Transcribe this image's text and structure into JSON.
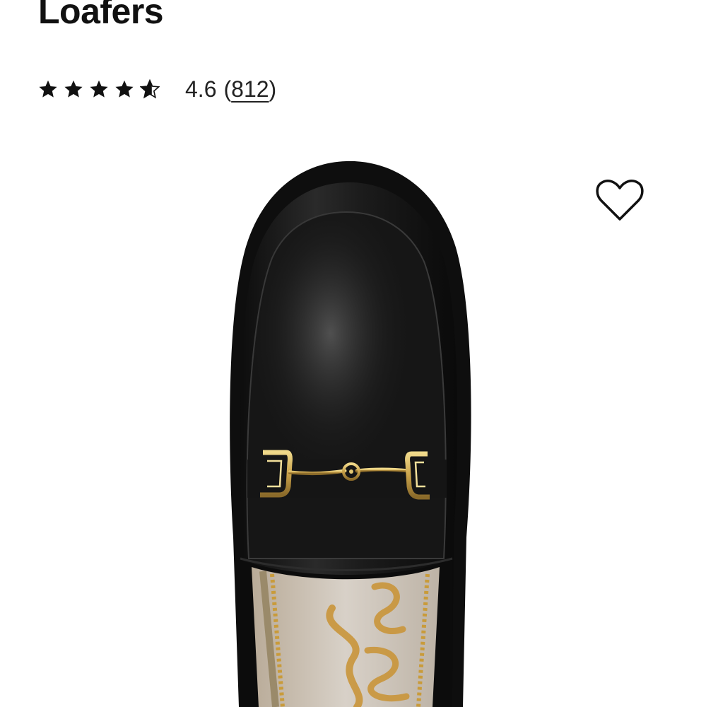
{
  "product": {
    "title": "Loafers",
    "rating": {
      "value": "4.6",
      "review_count": "812",
      "stars_filled": 4.6,
      "stars_total": 5
    }
  },
  "wishlist": {
    "icon": "heart-outline-icon"
  },
  "image": {
    "subject": "black leather loafer with gold horsebit",
    "insole_text": "Sam"
  },
  "colors": {
    "text": "#111111",
    "shoe": "#141414",
    "hardware": "#c9a24a",
    "insole": "#cfc6bc"
  }
}
